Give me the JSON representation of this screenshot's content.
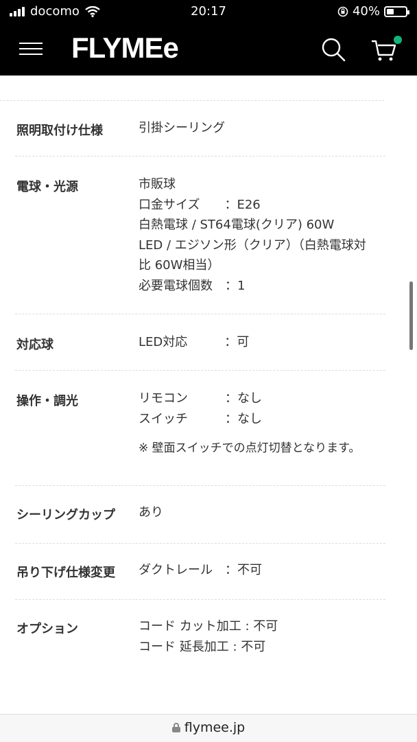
{
  "status_bar": {
    "carrier": "docomo",
    "time": "20:17",
    "battery": "40%",
    "battery_level": 0.4
  },
  "header": {
    "logo": "FLYMEe",
    "cart_badge_color": "#11b57a"
  },
  "specs": [
    {
      "label": "照明取付け仕様",
      "lines": [
        "引掛シーリング"
      ]
    },
    {
      "label": "電球・光源",
      "lines": [
        "市販球",
        "口金サイズ　　：E26",
        "白熱電球 / ST64電球(クリア) 60W",
        "LED / エジソン形（クリア）（白熱電球対",
        "比 60W相当）",
        "必要電球個数　：1"
      ]
    },
    {
      "label": "対応球",
      "lines": [
        "LED対応　　　：可"
      ]
    },
    {
      "label": "操作・調光",
      "lines": [
        "リモコン　　　：なし",
        "スイッチ　　　：なし"
      ],
      "note": "※ 壁面スイッチでの点灯切替となります。"
    },
    {
      "label": "シーリングカップ",
      "lines": [
        "あり"
      ]
    },
    {
      "label": "吊り下げ仕様変更",
      "lines": [
        "ダクトレール　：不可"
      ]
    },
    {
      "label": "オプション",
      "lines": [
        "コード カット加工 : 不可",
        "コード 延長加工 : 不可"
      ]
    }
  ],
  "bottom_bar": {
    "url": "flymee.jp"
  }
}
